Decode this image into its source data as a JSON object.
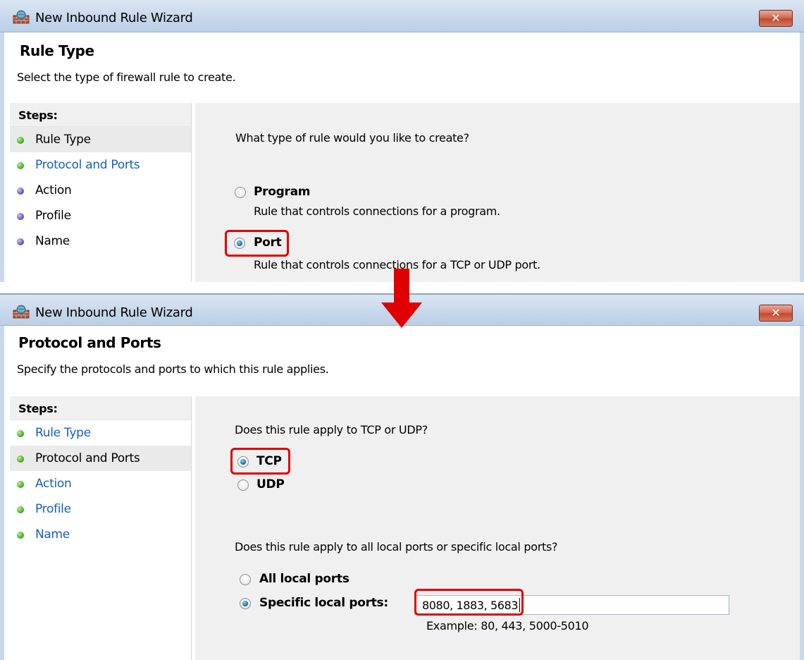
{
  "screen1": {
    "window_title": "New Inbound Rule Wizard",
    "close_label": "✕",
    "page_title": "Rule Type",
    "page_subtitle": "Select the type of firewall rule to create.",
    "steps_title": "Steps:",
    "steps": [
      {
        "label": "Rule Type",
        "state": "current",
        "dot": "green"
      },
      {
        "label": "Protocol and Ports",
        "state": "link",
        "dot": "green"
      },
      {
        "label": "Action",
        "state": "pending",
        "dot": "purple"
      },
      {
        "label": "Profile",
        "state": "pending",
        "dot": "purple"
      },
      {
        "label": "Name",
        "state": "pending",
        "dot": "purple"
      }
    ],
    "question": "What type of rule would you like to create?",
    "options": [
      {
        "label": "Program",
        "description": "Rule that controls connections for a program.",
        "checked": false
      },
      {
        "label": "Port",
        "description": "Rule that controls connections for a TCP or UDP port.",
        "checked": true
      }
    ]
  },
  "screen2": {
    "window_title": "New Inbound Rule Wizard",
    "close_label": "✕",
    "page_title": "Protocol and Ports",
    "page_subtitle": "Specify the protocols and ports to which this rule applies.",
    "steps_title": "Steps:",
    "steps": [
      {
        "label": "Rule Type",
        "state": "link",
        "dot": "green"
      },
      {
        "label": "Protocol and Ports",
        "state": "current",
        "dot": "green"
      },
      {
        "label": "Action",
        "state": "link",
        "dot": "green"
      },
      {
        "label": "Profile",
        "state": "link",
        "dot": "green"
      },
      {
        "label": "Name",
        "state": "link",
        "dot": "green"
      }
    ],
    "protocol_question": "Does this rule apply to TCP or UDP?",
    "protocols": [
      {
        "label": "TCP",
        "checked": true
      },
      {
        "label": "UDP",
        "checked": false
      }
    ],
    "ports_question": "Does this rule apply to all local ports or specific local ports?",
    "port_options": [
      {
        "label": "All local ports",
        "checked": false
      },
      {
        "label": "Specific local ports:",
        "checked": true
      }
    ],
    "ports_value": "8080, 1883, 5683",
    "ports_example": "Example: 80, 443, 5000-5010"
  },
  "colors": {
    "highlight": "#e00000",
    "arrow": "#e00000",
    "link": "#1560c0",
    "titlebar": "#c9d9ec"
  },
  "icons": {
    "app": "firewall-brick-globe-icon",
    "close": "close-icon",
    "arrow": "down-arrow-icon"
  }
}
